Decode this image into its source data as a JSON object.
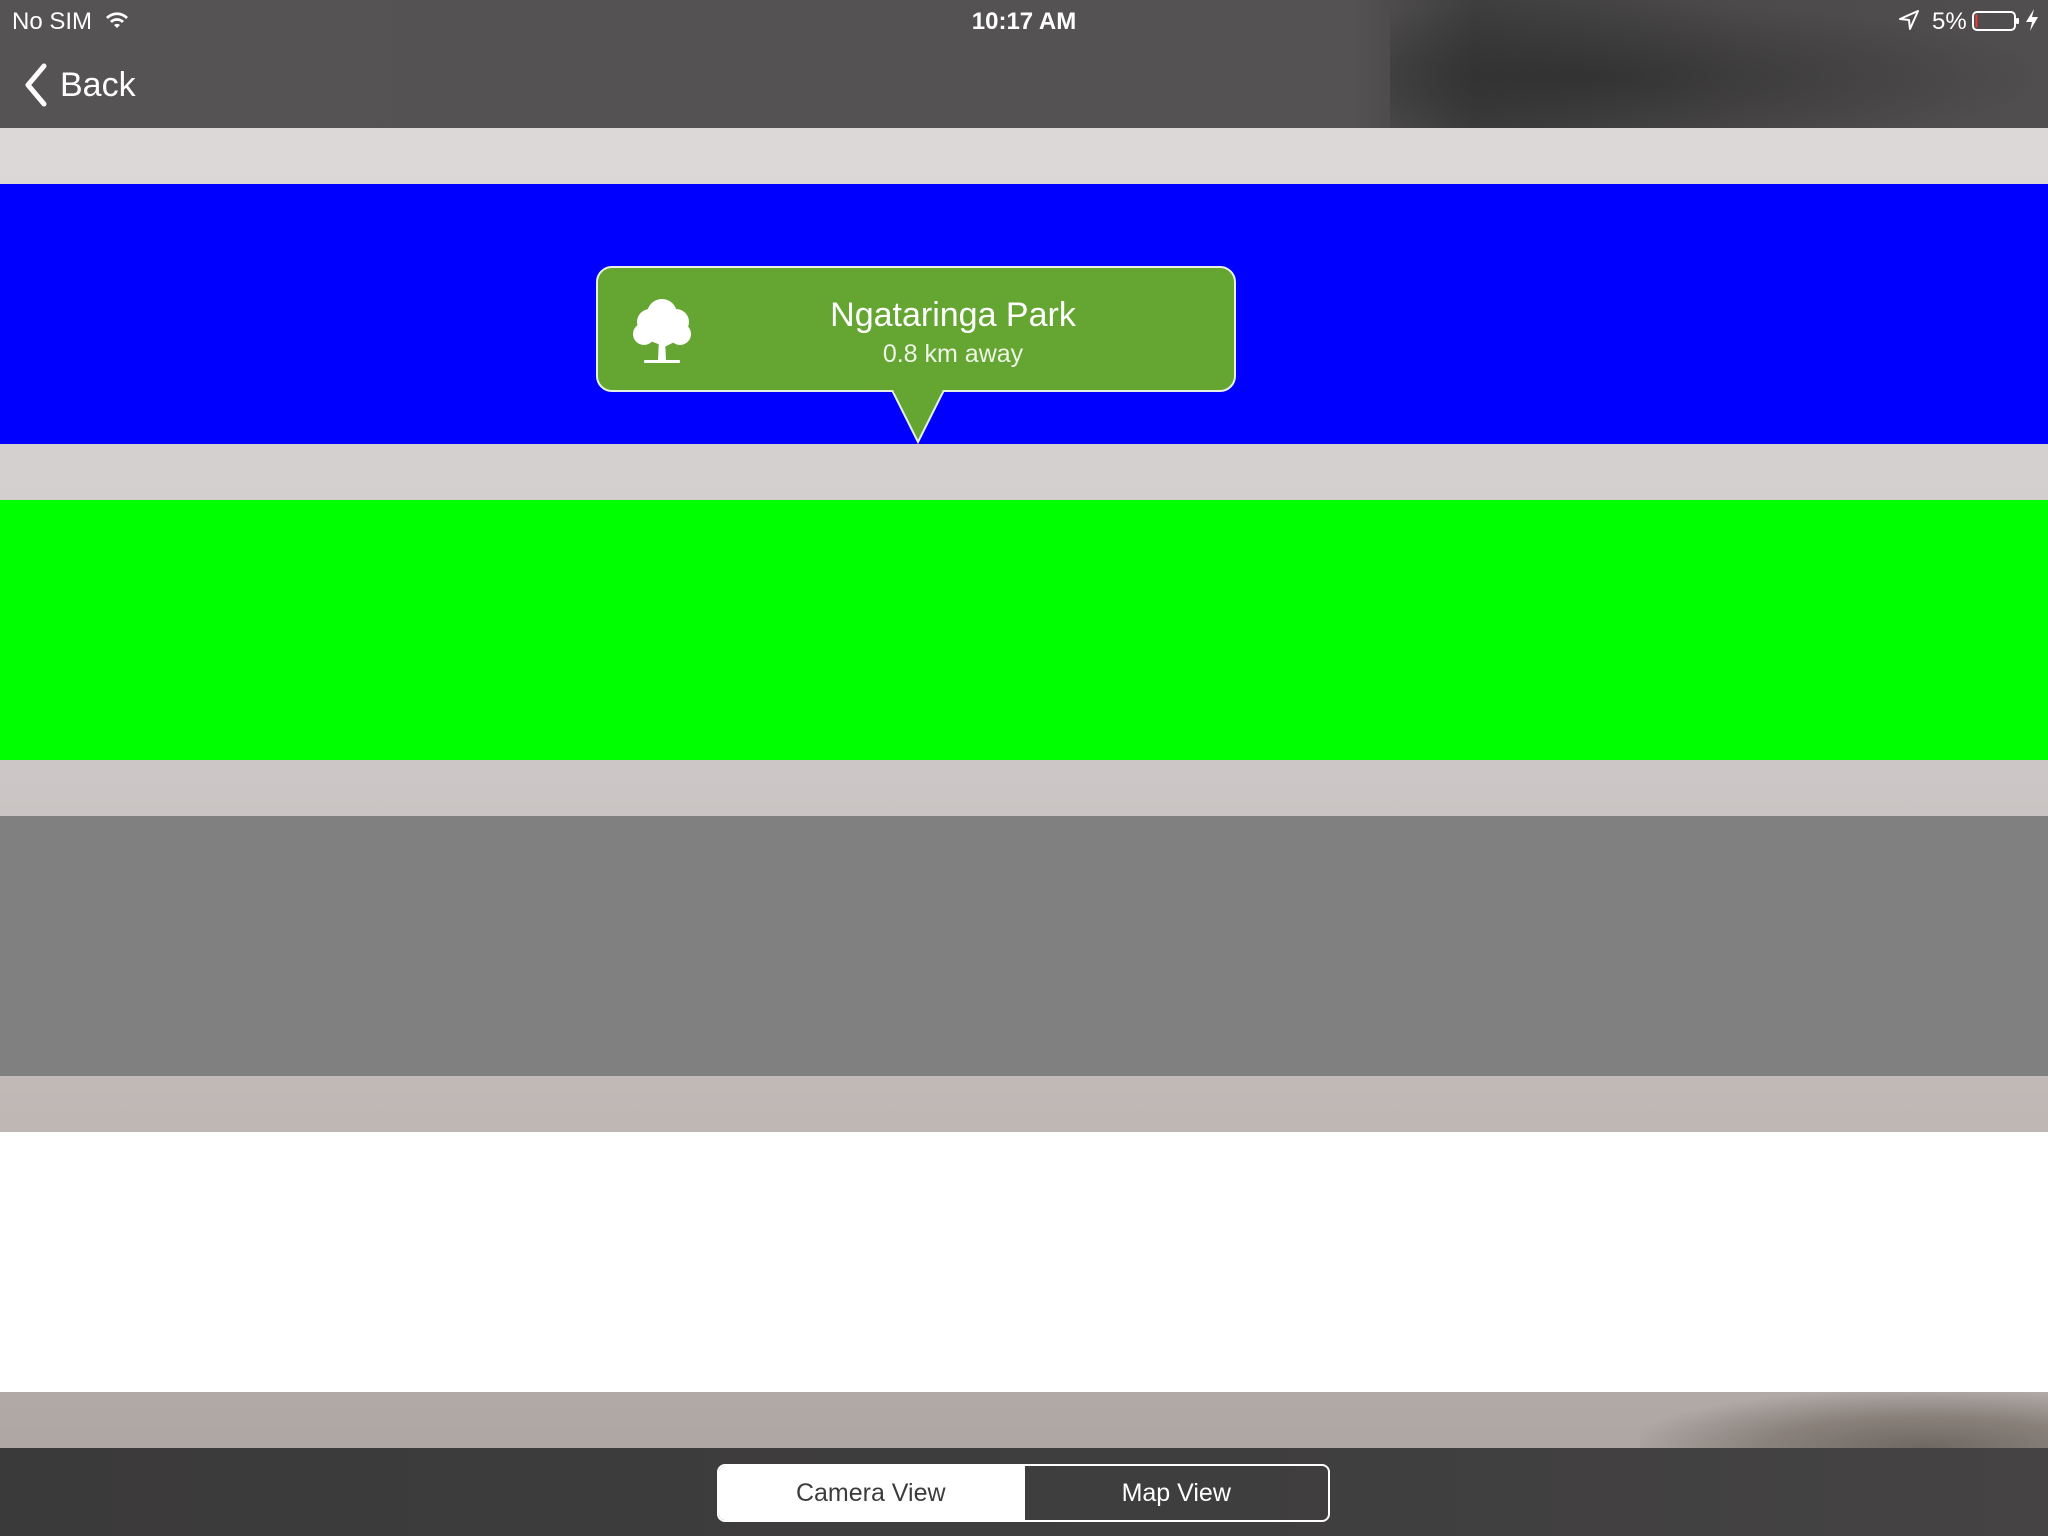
{
  "status_bar": {
    "carrier": "No SIM",
    "time": "10:17 AM",
    "battery_percent": "5%",
    "battery_level": 0.05,
    "icons": [
      "wifi-icon",
      "location-arrow-icon",
      "battery-icon",
      "charging-bolt-icon"
    ]
  },
  "nav": {
    "back_label": "Back",
    "back_icon": "chevron-left-icon"
  },
  "bands": {
    "colors": [
      "#0000ff",
      "#00ff00",
      "#808080",
      "#ffffff"
    ]
  },
  "callout": {
    "title": "Ngataringa Park",
    "subtitle": "0.8 km away",
    "icon": "tree-icon",
    "color": "#65a532"
  },
  "segmented_control": {
    "options": [
      {
        "label": "Camera View",
        "selected": true
      },
      {
        "label": "Map View",
        "selected": false
      }
    ]
  }
}
